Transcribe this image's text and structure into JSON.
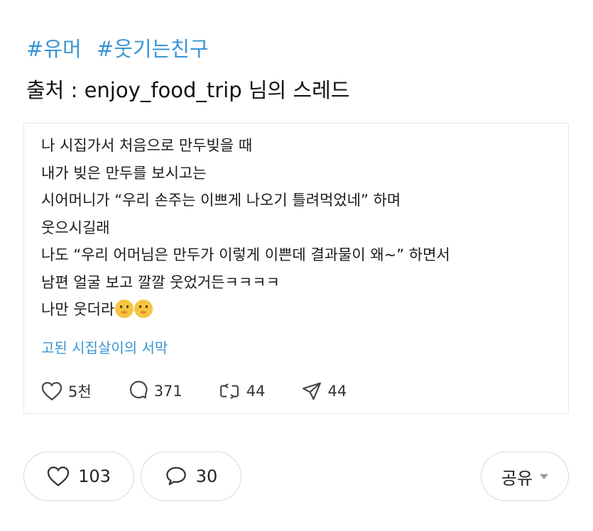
{
  "header": {
    "hashtags": [
      "#유머",
      "#웃기는친구"
    ],
    "source": "출처 : enjoy_food_trip 님의 스레드"
  },
  "post": {
    "lines": [
      "나 시집가서 처음으로 만두빚을 때",
      "내가 빚은 만두를 보시고는",
      "시어머니가 “우리 손주는 이쁘게 나오기 틀려먹었네” 하며",
      "웃으시길래",
      "나도 “우리 어머님은 만두가 이렇게 이쁜데 결과물이 왜~” 하면서",
      "남편 얼굴 보고 깔깔 웃었거든ㅋㅋㅋㅋ",
      "나만 웃더라"
    ],
    "emoji_icons": [
      "shushing-face-emoji",
      "shushing-face-emoji"
    ],
    "thread_link": "고된 시집살이의 서막",
    "stats": {
      "likes": "5천",
      "comments": "371",
      "reposts": "44",
      "shares": "44"
    }
  },
  "actions": {
    "like_count": "103",
    "comment_count": "30",
    "share_label": "공유"
  },
  "colors": {
    "accent": "#3a94d4",
    "border": "#d9d9d9"
  }
}
